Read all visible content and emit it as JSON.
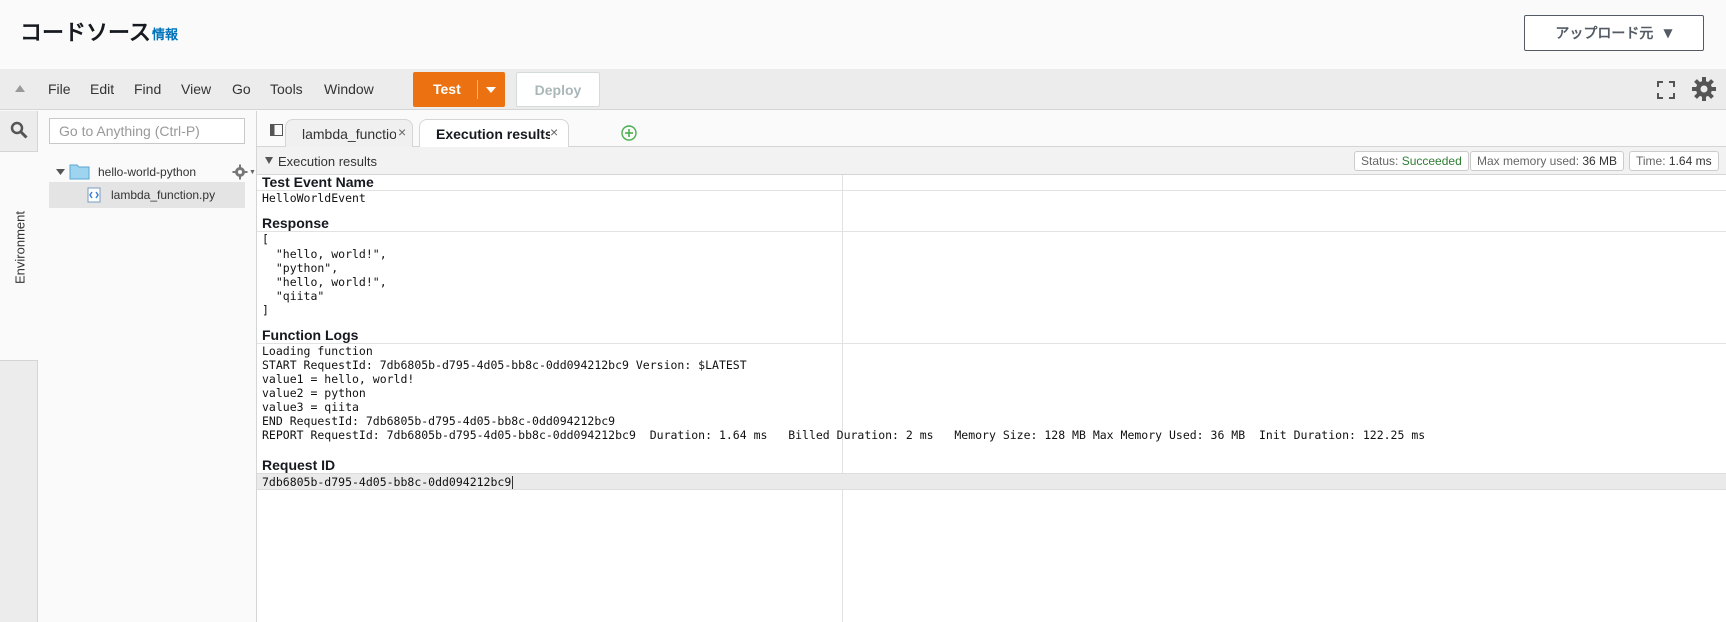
{
  "header": {
    "title": "コードソース",
    "info_link": "情報",
    "upload_button": "アップロード元",
    "upload_caret": "▼"
  },
  "menubar": {
    "items": [
      "File",
      "Edit",
      "Find",
      "View",
      "Go",
      "Tools",
      "Window"
    ],
    "test_label": "Test",
    "deploy_label": "Deploy"
  },
  "rail": {
    "environment_tab": "Environment"
  },
  "tree": {
    "goto_placeholder": "Go to Anything (Ctrl-P)",
    "folder_name": "hello-world-python",
    "file_name": "lambda_function.py"
  },
  "tabs": [
    {
      "label": "lambda_function.",
      "close": "×",
      "active": false
    },
    {
      "label": "Execution results",
      "close": "×",
      "active": true
    }
  ],
  "results": {
    "header_label": "Execution results",
    "status_label": "Status:",
    "status_value": "Succeeded",
    "memory_label": "Max memory used:",
    "memory_value": "36 MB",
    "time_label": "Time:",
    "time_value": "1.64 ms",
    "test_event_name_title": "Test Event Name",
    "test_event_name": "HelloWorldEvent",
    "response_title": "Response",
    "response_lines": [
      "[",
      "  \"hello, world!\",",
      "  \"python\",",
      "  \"hello, world!\",",
      "  \"qiita\"",
      "]"
    ],
    "logs_title": "Function Logs",
    "log_lines": [
      "Loading function",
      "START RequestId: 7db6805b-d795-4d05-bb8c-0dd094212bc9 Version: $LATEST",
      "value1 = hello, world!",
      "value2 = python",
      "value3 = qiita",
      "END RequestId: 7db6805b-d795-4d05-bb8c-0dd094212bc9",
      "REPORT RequestId: 7db6805b-d795-4d05-bb8c-0dd094212bc9  Duration: 1.64 ms   Billed Duration: 2 ms   Memory Size: 128 MB Max Memory Used: 36 MB  Init Duration: 122.25 ms"
    ],
    "request_id_title": "Request ID",
    "request_id": "7db6805b-d795-4d05-bb8c-0dd094212bc9"
  },
  "colors": {
    "accent_orange": "#ec7211",
    "link_blue": "#0073bb",
    "success_green": "#2e7d32"
  }
}
